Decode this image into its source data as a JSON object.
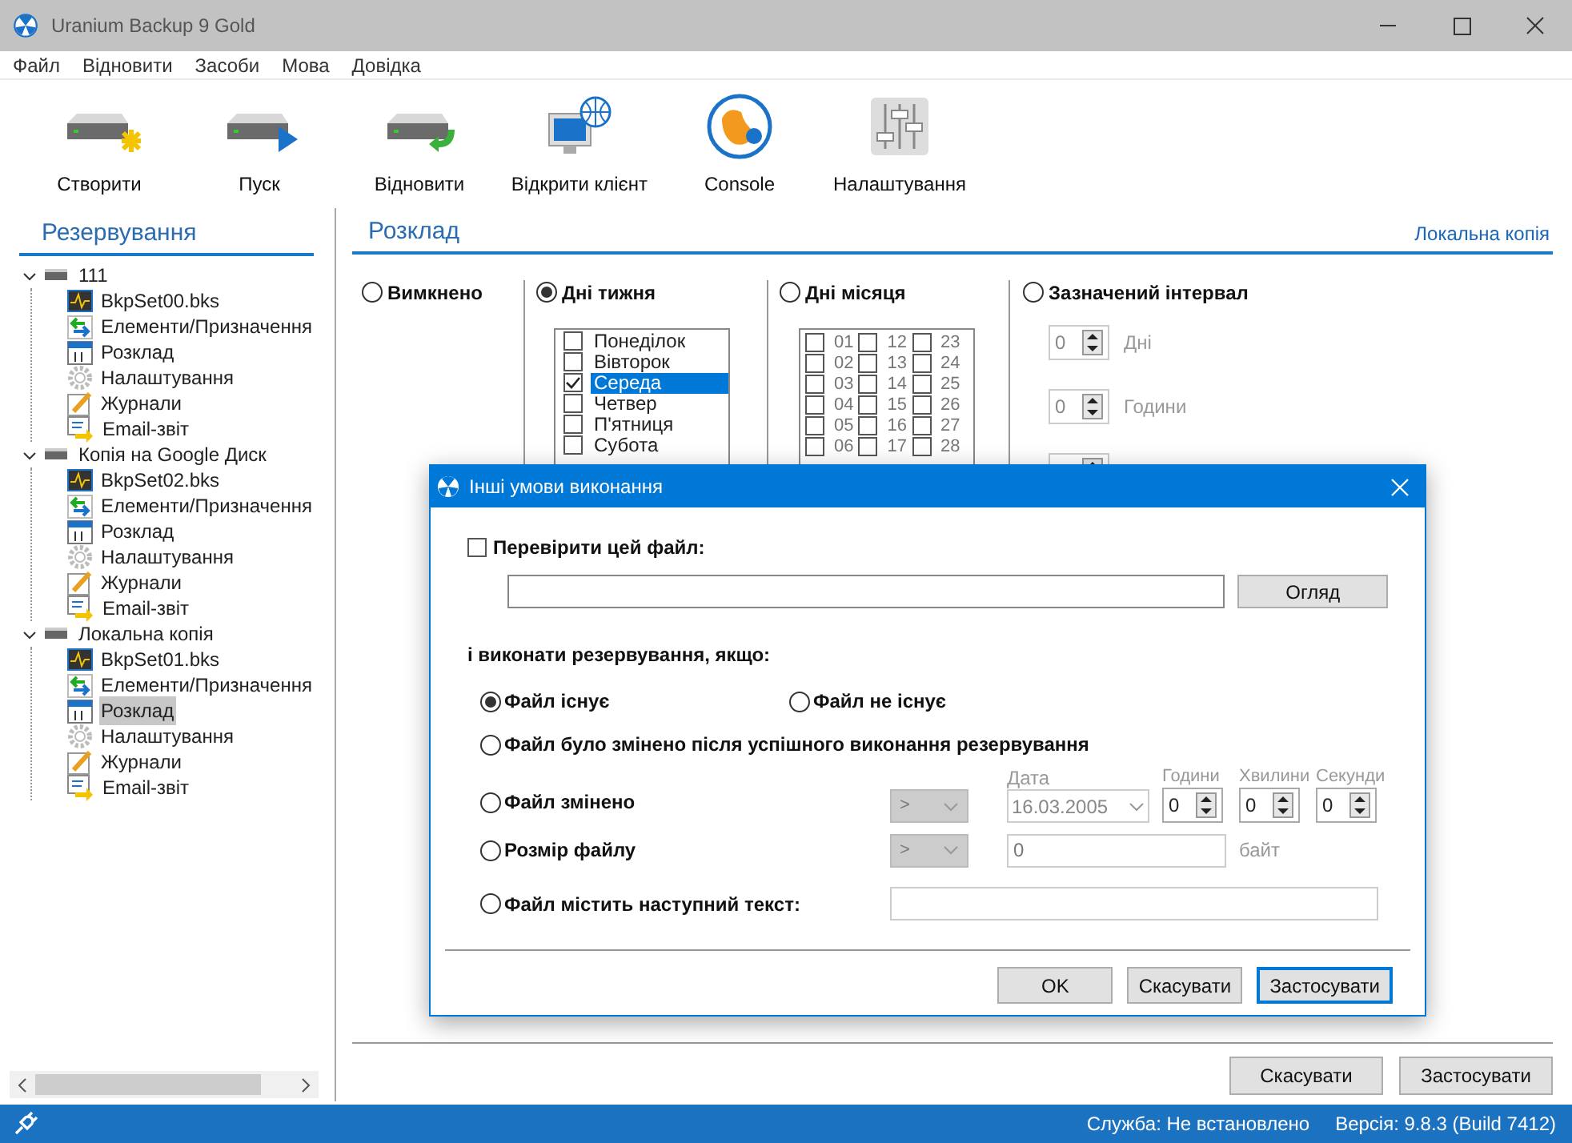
{
  "window": {
    "title": "Uranium Backup 9 Gold"
  },
  "menu": [
    "Файл",
    "Відновити",
    "Засоби",
    "Мова",
    "Довідка"
  ],
  "toolbar": [
    {
      "kind": "create",
      "label": "Створити"
    },
    {
      "kind": "run",
      "label": "Пуск"
    },
    {
      "kind": "restore",
      "label": "Відновити"
    },
    {
      "kind": "client",
      "label": "Відкрити клієнт"
    },
    {
      "kind": "console",
      "label": "Console"
    },
    {
      "kind": "settings",
      "label": "Налаштування"
    }
  ],
  "sidebar": {
    "title": "Резервування",
    "tree": [
      {
        "label": "111",
        "expanded": true,
        "children": [
          {
            "kind": "set",
            "label": "BkpSet00.bks",
            "selected": false
          },
          {
            "kind": "items",
            "label": "Елементи/Призначення",
            "selected": false
          },
          {
            "kind": "schedule",
            "label": "Розклад",
            "selected": false
          },
          {
            "kind": "settings",
            "label": "Налаштування",
            "selected": false
          },
          {
            "kind": "logs",
            "label": "Журнали",
            "selected": false
          },
          {
            "kind": "email",
            "label": "Email-звіт",
            "selected": false
          }
        ]
      },
      {
        "label": "Копія на Google Диск",
        "expanded": true,
        "children": [
          {
            "kind": "set",
            "label": "BkpSet02.bks",
            "selected": false
          },
          {
            "kind": "items",
            "label": "Елементи/Призначення",
            "selected": false
          },
          {
            "kind": "schedule",
            "label": "Розклад",
            "selected": false
          },
          {
            "kind": "settings",
            "label": "Налаштування",
            "selected": false
          },
          {
            "kind": "logs",
            "label": "Журнали",
            "selected": false
          },
          {
            "kind": "email",
            "label": "Email-звіт",
            "selected": false
          }
        ]
      },
      {
        "label": "Локальна копія",
        "expanded": true,
        "children": [
          {
            "kind": "set",
            "label": "BkpSet01.bks",
            "selected": false
          },
          {
            "kind": "items",
            "label": "Елементи/Призначення",
            "selected": false
          },
          {
            "kind": "schedule",
            "label": "Розклад",
            "selected": true
          },
          {
            "kind": "settings",
            "label": "Налаштування",
            "selected": false
          },
          {
            "kind": "logs",
            "label": "Журнали",
            "selected": false
          },
          {
            "kind": "email",
            "label": "Email-звіт",
            "selected": false
          }
        ]
      }
    ]
  },
  "schedule": {
    "title": "Розклад",
    "link": "Локальна копія",
    "modes": [
      {
        "kind": "off",
        "label": "Вимкнено",
        "selected": false
      },
      {
        "kind": "weekdays",
        "label": "Дні тижня",
        "selected": true,
        "days": [
          {
            "label": "Понеділок",
            "checked": false,
            "selected": false
          },
          {
            "label": "Вівторок",
            "checked": false,
            "selected": false
          },
          {
            "label": "Середа",
            "checked": true,
            "selected": true
          },
          {
            "label": "Четвер",
            "checked": false,
            "selected": false
          },
          {
            "label": "П'ятниця",
            "checked": false,
            "selected": false
          },
          {
            "label": "Субота",
            "checked": false,
            "selected": false
          }
        ]
      },
      {
        "kind": "monthdays",
        "label": "Дні місяця",
        "selected": false,
        "columns": [
          [
            {
              "label": "01",
              "checked": false
            },
            {
              "label": "02",
              "checked": false
            },
            {
              "label": "03",
              "checked": false
            },
            {
              "label": "04",
              "checked": false
            },
            {
              "label": "05",
              "checked": false
            },
            {
              "label": "06",
              "checked": false
            }
          ],
          [
            {
              "label": "12",
              "checked": false
            },
            {
              "label": "13",
              "checked": false
            },
            {
              "label": "14",
              "checked": false
            },
            {
              "label": "15",
              "checked": false
            },
            {
              "label": "16",
              "checked": false
            },
            {
              "label": "17",
              "checked": false
            }
          ],
          [
            {
              "label": "23",
              "checked": false
            },
            {
              "label": "24",
              "checked": false
            },
            {
              "label": "25",
              "checked": false
            },
            {
              "label": "26",
              "checked": false
            },
            {
              "label": "27",
              "checked": false
            },
            {
              "label": "28",
              "checked": false
            }
          ]
        ]
      },
      {
        "kind": "interval",
        "label": "Зазначений інтервал",
        "selected": false,
        "fields": [
          {
            "value": "0",
            "unit": "Дні"
          },
          {
            "value": "0",
            "unit": "Години"
          }
        ]
      }
    ]
  },
  "buttons": [
    "Скасувати",
    "Застосувати"
  ],
  "status_bar": {
    "service": "Служба: Не встановлено",
    "version": "Версія: 9.8.3 (Build 7412)"
  },
  "dialog": {
    "title": "Інші умови виконання",
    "check": {
      "label": "Перевірити цей файл:",
      "checked": false
    },
    "browse": "Огляд",
    "subtitle": "і виконати резервування, якщо:",
    "conditions": [
      {
        "kind": "pair",
        "options": [
          {
            "label": "Файл існує",
            "selected": true
          },
          {
            "label": "Файл не існує",
            "selected": false
          }
        ]
      },
      {
        "kind": "plain",
        "label": "Файл було змінено після успішного виконання резервування",
        "selected": false
      },
      {
        "kind": "modified",
        "label": "Файл змінено",
        "selected": false,
        "operator": ">",
        "date_label": "Дата",
        "date": "16.03.2005",
        "spinners": [
          {
            "label": "Години",
            "value": "0"
          },
          {
            "label": "Хвилини",
            "value": "0"
          },
          {
            "label": "Секунди",
            "value": "0"
          }
        ]
      },
      {
        "kind": "size",
        "label": "Розмір файлу",
        "selected": false,
        "operator": ">",
        "value": "0",
        "unit": "байт"
      },
      {
        "kind": "text",
        "label": "Файл містить наступний текст:",
        "selected": false
      }
    ],
    "buttons": [
      {
        "label": "OK",
        "default": false
      },
      {
        "label": "Скасувати",
        "default": false
      },
      {
        "label": "Застосувати",
        "default": true
      }
    ]
  }
}
